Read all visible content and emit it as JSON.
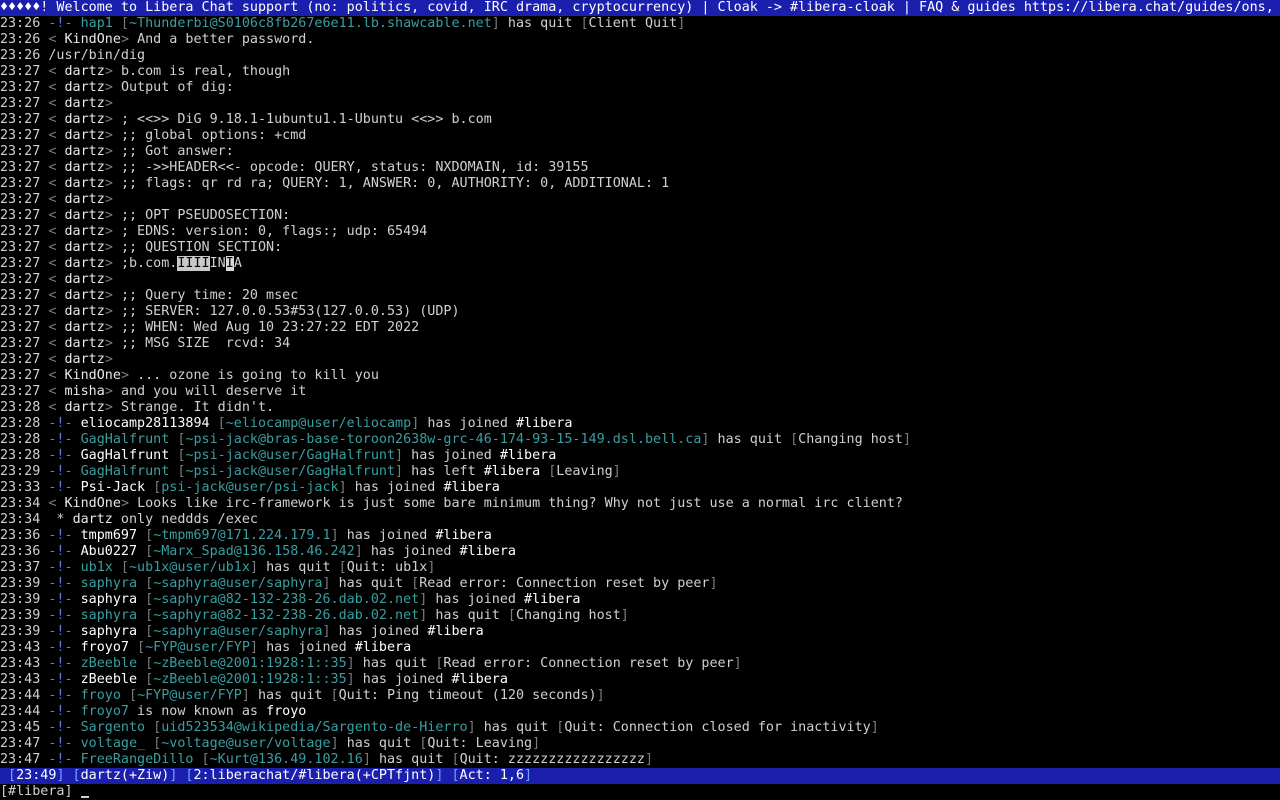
{
  "topic": "♦♦♦♦♦! Welcome to Libera Chat support (no: politics, covid, IRC drama, cryptocurrency) | Cloak -> #libera-cloak | FAQ & guides https://libera.chat/guides/ons,",
  "lines": [
    {
      "t": "23:26",
      "k": "event",
      "who": "hap1",
      "who_style": "quit",
      "host": "~Thunderbi@S0106c8fb267e6e11.lb.shawcable.net",
      "action": "has quit",
      "reason": "Client Quit"
    },
    {
      "t": "23:26",
      "k": "msg",
      "nick": "KindOne",
      "text": "And a better password."
    },
    {
      "t": "23:26",
      "k": "plain",
      "text": "/usr/bin/dig"
    },
    {
      "t": "23:27",
      "k": "msg",
      "nick": "dartz",
      "text": "b.com is real, though"
    },
    {
      "t": "23:27",
      "k": "msg",
      "nick": "dartz",
      "text": "Output of dig:"
    },
    {
      "t": "23:27",
      "k": "msg",
      "nick": "dartz",
      "text": ""
    },
    {
      "t": "23:27",
      "k": "msg",
      "nick": "dartz",
      "text": "; <<>> DiG 9.18.1-1ubuntu1.1-Ubuntu <<>> b.com"
    },
    {
      "t": "23:27",
      "k": "msg",
      "nick": "dartz",
      "text": ";; global options: +cmd"
    },
    {
      "t": "23:27",
      "k": "msg",
      "nick": "dartz",
      "text": ";; Got answer:"
    },
    {
      "t": "23:27",
      "k": "msg",
      "nick": "dartz",
      "text": ";; ->>HEADER<<- opcode: QUERY, status: NXDOMAIN, id: 39155"
    },
    {
      "t": "23:27",
      "k": "msg",
      "nick": "dartz",
      "text": ";; flags: qr rd ra; QUERY: 1, ANSWER: 0, AUTHORITY: 0, ADDITIONAL: 1"
    },
    {
      "t": "23:27",
      "k": "msg",
      "nick": "dartz",
      "text": ""
    },
    {
      "t": "23:27",
      "k": "msg",
      "nick": "dartz",
      "text": ";; OPT PSEUDOSECTION:"
    },
    {
      "t": "23:27",
      "k": "msg",
      "nick": "dartz",
      "text": "; EDNS: version: 0, flags:; udp: 65494"
    },
    {
      "t": "23:27",
      "k": "msg",
      "nick": "dartz",
      "text": ";; QUESTION SECTION:"
    },
    {
      "t": "23:27",
      "k": "msgq",
      "nick": "dartz",
      "pre": ";b.com.",
      "hl1": "IIII",
      "mid": "IN",
      "hl2": "I",
      "post": "A"
    },
    {
      "t": "23:27",
      "k": "msg",
      "nick": "dartz",
      "text": ""
    },
    {
      "t": "23:27",
      "k": "msg",
      "nick": "dartz",
      "text": ";; Query time: 20 msec"
    },
    {
      "t": "23:27",
      "k": "msg",
      "nick": "dartz",
      "text": ";; SERVER: 127.0.0.53#53(127.0.0.53) (UDP)"
    },
    {
      "t": "23:27",
      "k": "msg",
      "nick": "dartz",
      "text": ";; WHEN: Wed Aug 10 23:27:22 EDT 2022"
    },
    {
      "t": "23:27",
      "k": "msg",
      "nick": "dartz",
      "text": ";; MSG SIZE  rcvd: 34"
    },
    {
      "t": "23:27",
      "k": "msg",
      "nick": "dartz",
      "text": ""
    },
    {
      "t": "23:27",
      "k": "msg",
      "nick": "KindOne",
      "text": "... ozone is going to kill you"
    },
    {
      "t": "23:27",
      "k": "msg",
      "nick": "misha",
      "text": "and you will deserve it"
    },
    {
      "t": "23:28",
      "k": "msg",
      "nick": "dartz",
      "text": "Strange. It didn't."
    },
    {
      "t": "23:28",
      "k": "event",
      "who": "eliocamp28113894",
      "who_style": "join",
      "host": "~eliocamp@user/eliocamp",
      "action": "has joined",
      "chan": "#libera"
    },
    {
      "t": "23:28",
      "k": "event",
      "who": "GagHalfrunt",
      "who_style": "quit",
      "host": "~psi-jack@bras-base-toroon2638w-grc-46-174-93-15-149.dsl.bell.ca",
      "action": "has quit",
      "reason": "Changing host"
    },
    {
      "t": "23:28",
      "k": "event",
      "who": "GagHalfrunt",
      "who_style": "join",
      "host": "~psi-jack@user/GagHalfrunt",
      "action": "has joined",
      "chan": "#libera"
    },
    {
      "t": "23:29",
      "k": "event",
      "who": "GagHalfrunt",
      "who_style": "quit",
      "host": "~psi-jack@user/GagHalfrunt",
      "action": "has left",
      "chan": "#libera",
      "reason": "Leaving"
    },
    {
      "t": "23:33",
      "k": "event",
      "who": "Psi-Jack",
      "who_style": "join",
      "host": "psi-jack@user/psi-jack",
      "action": "has joined",
      "chan": "#libera"
    },
    {
      "t": "23:34",
      "k": "msg",
      "nick": "KindOne",
      "text": "Looks like irc-framework is just some bare minimum thing? Why not just use a normal irc client?"
    },
    {
      "t": "23:34",
      "k": "action",
      "nick": "dartz",
      "text": "only neddds /exec"
    },
    {
      "t": "23:36",
      "k": "event",
      "who": "tmpm697",
      "who_style": "join",
      "host": "~tmpm697@171.224.179.1",
      "action": "has joined",
      "chan": "#libera"
    },
    {
      "t": "23:36",
      "k": "event",
      "who": "Abu0227",
      "who_style": "join",
      "host": "~Marx_Spad@136.158.46.242",
      "action": "has joined",
      "chan": "#libera"
    },
    {
      "t": "23:37",
      "k": "event",
      "who": "ub1x",
      "who_style": "quit",
      "host": "~ub1x@user/ub1x",
      "action": "has quit",
      "reason": "Quit: ub1x"
    },
    {
      "t": "23:39",
      "k": "event",
      "who": "saphyra",
      "who_style": "quit",
      "host": "~saphyra@user/saphyra",
      "action": "has quit",
      "reason": "Read error: Connection reset by peer"
    },
    {
      "t": "23:39",
      "k": "event",
      "who": "saphyra",
      "who_style": "join",
      "host": "~saphyra@82-132-238-26.dab.02.net",
      "action": "has joined",
      "chan": "#libera"
    },
    {
      "t": "23:39",
      "k": "event",
      "who": "saphyra",
      "who_style": "quit",
      "host": "~saphyra@82-132-238-26.dab.02.net",
      "action": "has quit",
      "reason": "Changing host"
    },
    {
      "t": "23:39",
      "k": "event",
      "who": "saphyra",
      "who_style": "join",
      "host": "~saphyra@user/saphyra",
      "action": "has joined",
      "chan": "#libera"
    },
    {
      "t": "23:43",
      "k": "event",
      "who": "froyo7",
      "who_style": "join",
      "host": "~FYP@user/FYP",
      "action": "has joined",
      "chan": "#libera"
    },
    {
      "t": "23:43",
      "k": "event",
      "who": "zBeeble",
      "who_style": "quit",
      "host": "~zBeeble@2001:1928:1::35",
      "action": "has quit",
      "reason": "Read error: Connection reset by peer"
    },
    {
      "t": "23:43",
      "k": "event",
      "who": "zBeeble",
      "who_style": "join",
      "host": "~zBeeble@2001:1928:1::35",
      "action": "has joined",
      "chan": "#libera"
    },
    {
      "t": "23:44",
      "k": "event",
      "who": "froyo",
      "who_style": "quit",
      "host": "~FYP@user/FYP",
      "action": "has quit",
      "reason": "Quit: Ping timeout (120 seconds)"
    },
    {
      "t": "23:44",
      "k": "nick",
      "who": "froyo7",
      "text": "is now known as",
      "newnick": "froyo"
    },
    {
      "t": "23:45",
      "k": "event",
      "who": "Sargento",
      "who_style": "quit",
      "host": "uid523534@wikipedia/Sargento-de-Hierro",
      "action": "has quit",
      "reason": "Quit: Connection closed for inactivity"
    },
    {
      "t": "23:47",
      "k": "event",
      "who": "voltage_",
      "who_style": "quit",
      "host": "~voltage@user/voltage",
      "action": "has quit",
      "reason": "Quit: Leaving"
    },
    {
      "t": "23:47",
      "k": "event",
      "who": "FreeRangeDillo",
      "who_style": "quit",
      "host": "~Kurt@136.49.102.16",
      "action": "has quit",
      "reason": "Quit: zzzzzzzzzzzzzzzzz"
    }
  ],
  "status": {
    "time": "23:49",
    "user": "dartz(+Ziw)",
    "window": "2:liberachat/#libera(+CPTfjnt)",
    "act": "Act: 1,6"
  },
  "input": {
    "prompt": "[#libera]",
    "value": ""
  }
}
